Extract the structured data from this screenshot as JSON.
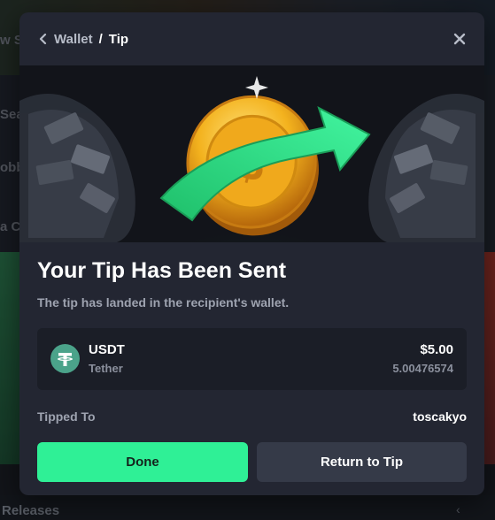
{
  "background": {
    "partial_texts": [
      "w S",
      "Sear",
      "obb",
      "a C"
    ],
    "releases_label": "Releases"
  },
  "modal": {
    "breadcrumb": {
      "parent": "Wallet",
      "separator": "/",
      "current": "Tip"
    },
    "title": "Your Tip Has Been Sent",
    "subtitle": "The tip has landed in the recipient's wallet.",
    "coin": {
      "symbol": "USDT",
      "name": "Tether",
      "usd_value": "$5.00",
      "amount": "5.00476574",
      "icon": "tether-icon"
    },
    "tipped_to": {
      "label": "Tipped To",
      "value": "toscakyo"
    },
    "buttons": {
      "done": "Done",
      "return": "Return to Tip"
    }
  },
  "colors": {
    "accent": "#2ff096",
    "modal_bg": "#232632",
    "card_bg": "#1b1e27",
    "tether": "#4ba38a"
  }
}
